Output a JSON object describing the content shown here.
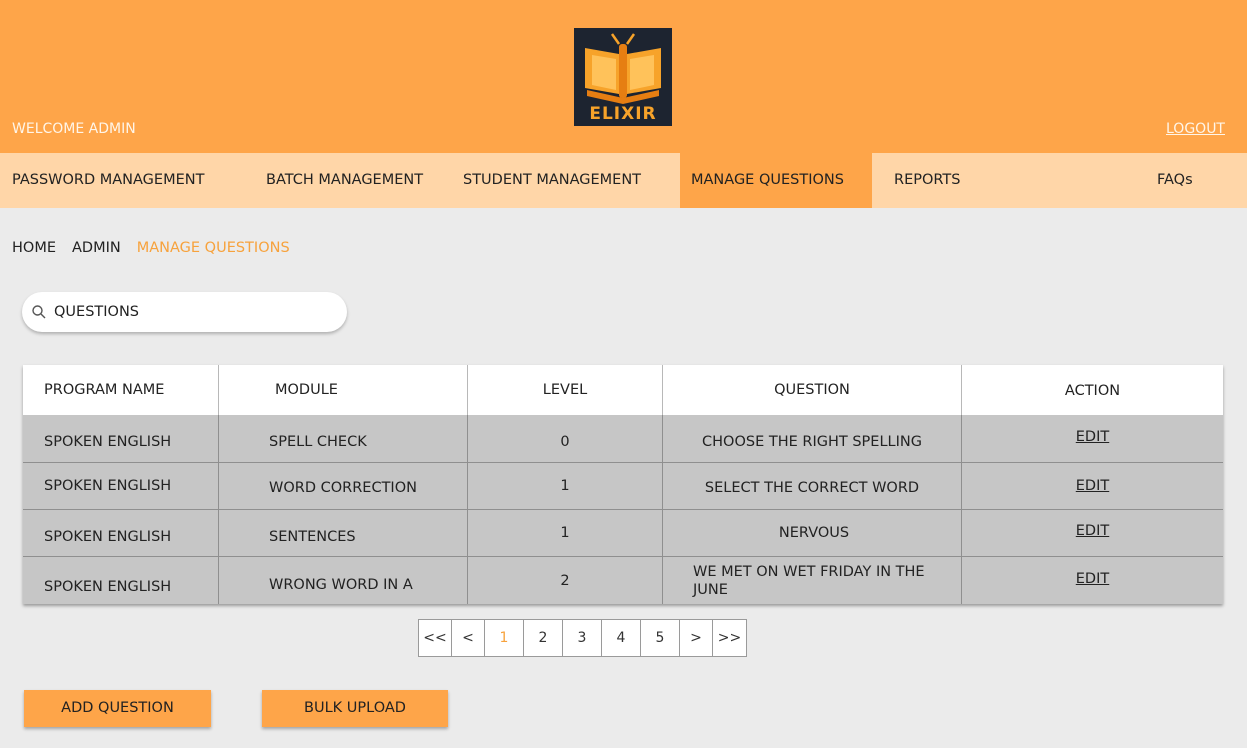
{
  "header": {
    "welcome": "WELCOME ADMIN",
    "logout": "LOGOUT",
    "logo_text": "ELIXIR",
    "bg_color": "#fea549"
  },
  "nav": {
    "items": [
      {
        "label": "PASSWORD MANAGEMENT"
      },
      {
        "label": "BATCH MANAGEMENT"
      },
      {
        "label": "STUDENT MANAGEMENT"
      },
      {
        "label": "MANAGE QUESTIONS",
        "active": true
      },
      {
        "label": "REPORTS"
      },
      {
        "label": "FAQs"
      }
    ]
  },
  "breadcrumb": [
    "HOME",
    "ADMIN",
    "MANAGE QUESTIONS"
  ],
  "search": {
    "value": "",
    "placeholder": "QUESTIONS",
    "icon": "search-icon"
  },
  "table": {
    "headers": [
      "PROGRAM NAME",
      "MODULE",
      "LEVEL",
      "QUESTION",
      "ACTION"
    ],
    "rows": [
      [
        "SPOKEN ENGLISH",
        "SPELL CHECK",
        "0",
        "CHOOSE THE RIGHT SPELLING",
        "EDIT"
      ],
      [
        "SPOKEN ENGLISH",
        "WORD CORRECTION",
        "1",
        "SELECT THE CORRECT WORD",
        "EDIT"
      ],
      [
        "SPOKEN ENGLISH",
        "SENTENCES",
        "1",
        "NERVOUS",
        "EDIT"
      ],
      [
        "SPOKEN ENGLISH",
        "WRONG WORD IN A",
        "2",
        "WE MET ON WET FRIDAY IN THE JUNE",
        "EDIT"
      ]
    ]
  },
  "pagination": {
    "first": "<<",
    "prev": "<",
    "pages": [
      "1",
      "2",
      "3",
      "4",
      "5"
    ],
    "current": "1",
    "next": ">",
    "last": ">>"
  },
  "buttons": {
    "add_question": "ADD QUESTION",
    "bulk_upload": "BULK UPLOAD"
  },
  "colors": {
    "accent": "#fea549",
    "nav_bg": "#ffd6a8",
    "active_text": "#f7a23c",
    "row_bg": "#c6c6c6",
    "page_bg": "#ebebeb"
  }
}
